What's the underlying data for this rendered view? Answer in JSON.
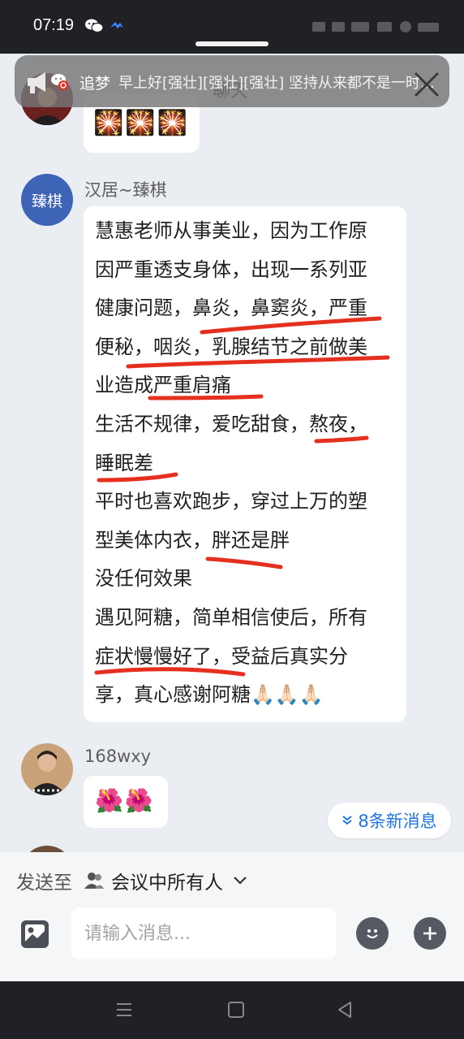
{
  "status_bar": {
    "time": "07:19"
  },
  "header": {
    "title": "聊天"
  },
  "notification": {
    "sender": "追梦",
    "text": "早上好[强壮][强壮][强壮] 坚持从来都不是一时的..."
  },
  "messages": [
    {
      "id": "m0",
      "emoji": "🎇🎇🎇"
    },
    {
      "id": "m1",
      "sender": "汉居~臻棋",
      "avatar_text": "臻棋",
      "lines": [
        "慧惠老师从事美业，因为工作原",
        "因严重透支身体，出现一系列亚",
        "健康问题，鼻炎，鼻窦炎，严重",
        "便秘，咽炎，乳腺结节之前做美",
        "业造成严重肩痛",
        "生活不规律，爱吃甜食，熬夜，",
        "睡眠差",
        "平时也喜欢跑步，穿过上万的塑",
        "型美体内衣，胖还是胖",
        "没任何效果",
        "遇见阿糖，简单相信使后，所有",
        "症状慢慢好了，受益后真实分",
        "享，真心感谢阿糖🙏🏻🙏🏻🙏🏻"
      ]
    },
    {
      "id": "m2",
      "sender": "168wxy",
      "emoji": "🌺🌺"
    }
  ],
  "new_messages_pill": {
    "label": "8条新消息",
    "icon": "double-chevron-down"
  },
  "composer": {
    "send_to_prefix": "发送至",
    "send_to_target": "会议中所有人",
    "placeholder": "请输入消息..."
  },
  "colors": {
    "accent": "#1d74e6",
    "underline": "#e5301f",
    "avatar_bg": "#3d64b6"
  }
}
